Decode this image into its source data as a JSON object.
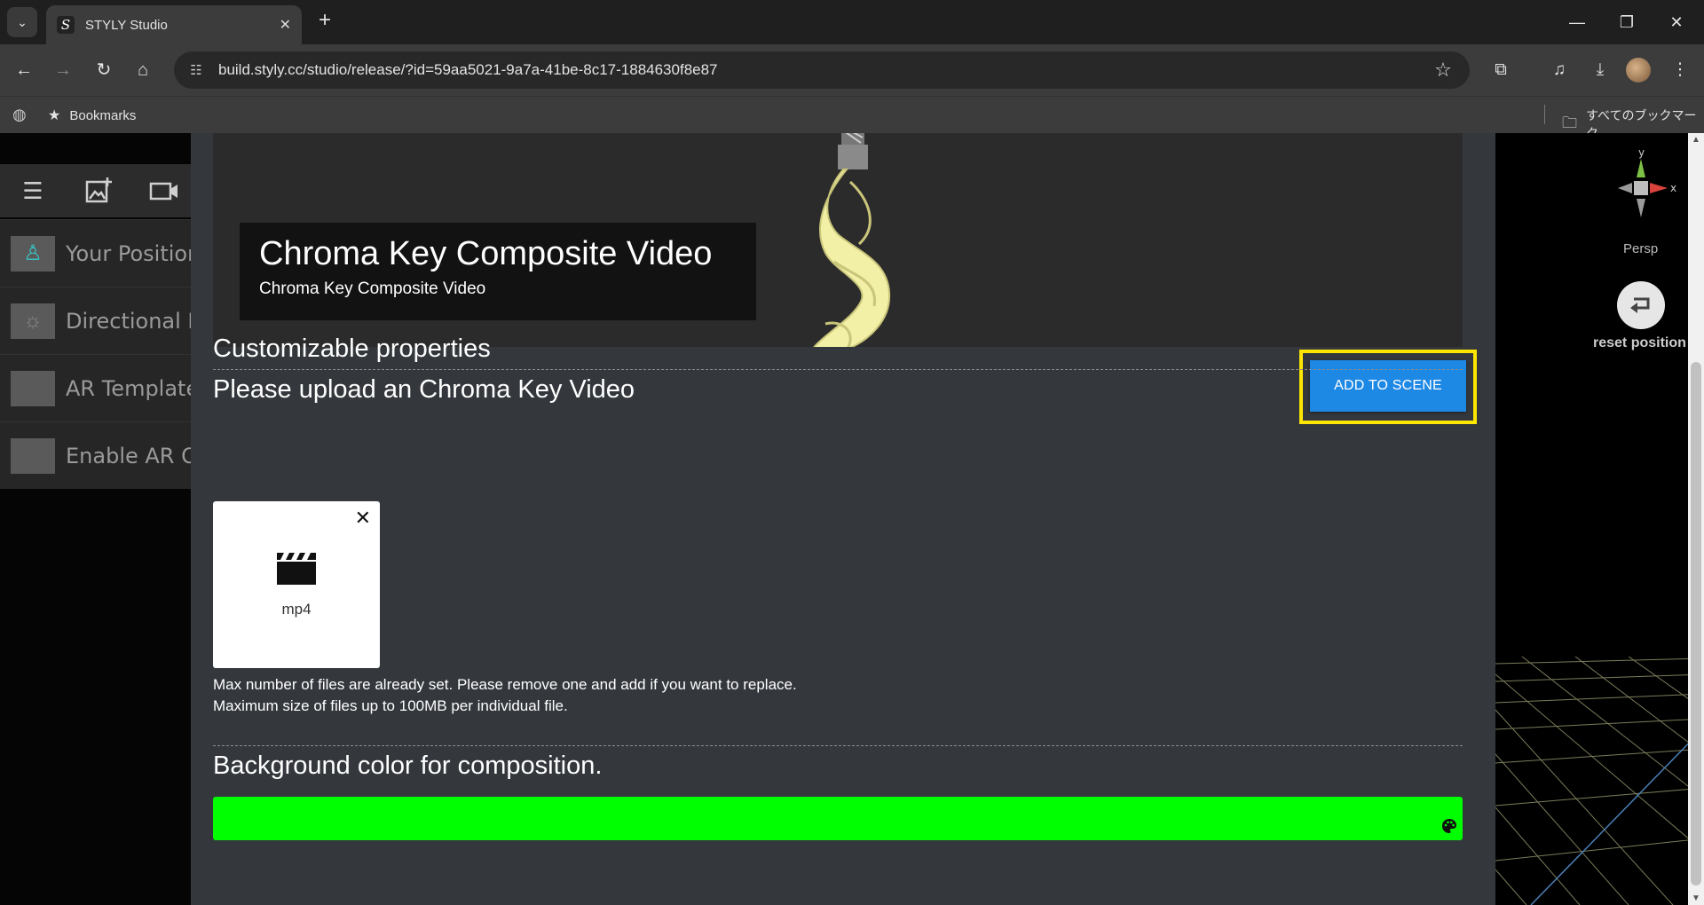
{
  "browser": {
    "tab_title": "STYLY Studio",
    "tab_close": "✕",
    "new_tab": "+",
    "url": "build.styly.cc/studio/release/?id=59aa5021-9a7a-41be-8c17-1884630f8e87",
    "bookmarks_label": "Bookmarks",
    "all_bookmarks_label": "すべてのブックマーク",
    "window": {
      "minimize": "—",
      "restore": "❐",
      "close": "✕"
    }
  },
  "layers": [
    {
      "name": "Your Position"
    },
    {
      "name": "Directional Li"
    },
    {
      "name": "AR Template"
    },
    {
      "name": "Enable AR Oc"
    }
  ],
  "asset": {
    "title": "Chroma Key Composite Video",
    "subtitle": "Chroma Key Composite Video",
    "add_button": "ADD TO SCENE"
  },
  "properties": {
    "heading": "Customizable properties",
    "upload_heading": "Please upload an Chroma Key Video",
    "file": {
      "ext": "mp4",
      "remove": "✕"
    },
    "note_line1": "Max number of files are already set. Please remove one and add if you want to replace.",
    "note_line2": "Maximum size of files up to 100MB per individual file.",
    "bg_heading": "Background color for composition.",
    "bg_color": "#00ff00"
  },
  "viewport": {
    "axis_y": "y",
    "axis_x": "x",
    "projection": "Persp",
    "reset_label": "reset position"
  },
  "colors": {
    "accent": "#1e88e5",
    "highlight": "#ffe600"
  }
}
